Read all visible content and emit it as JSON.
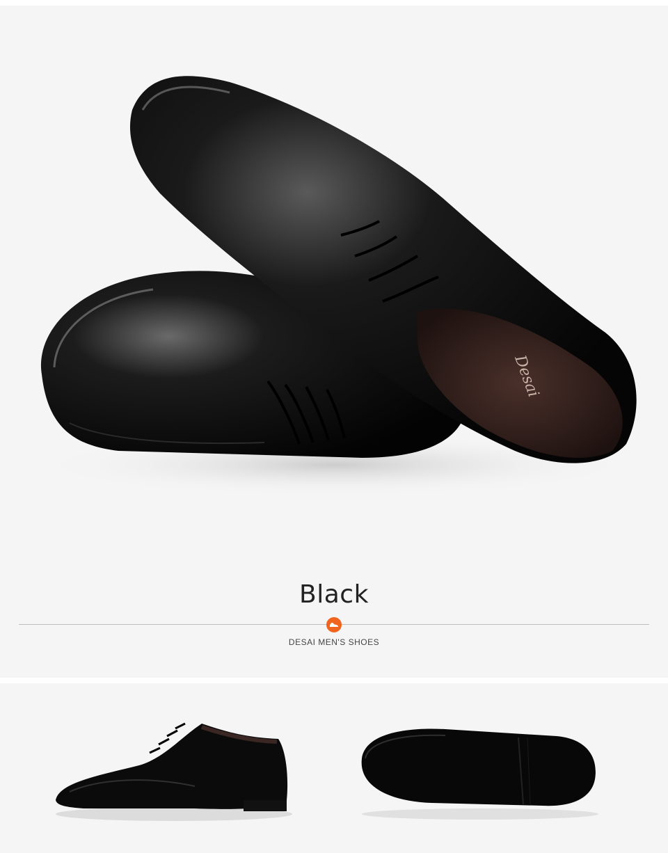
{
  "hero": {
    "color_name": "Black",
    "brand_line": "DESAI MEN'S SHOES",
    "insole_logo": "Desai",
    "fine_print": [
      "",
      "",
      ""
    ]
  },
  "badge": {
    "icon": "shoe-icon",
    "color": "#f0641e"
  },
  "colors": {
    "leather": "#0d0d0d",
    "background": "#f5f5f5",
    "insole": "#3a2622"
  }
}
